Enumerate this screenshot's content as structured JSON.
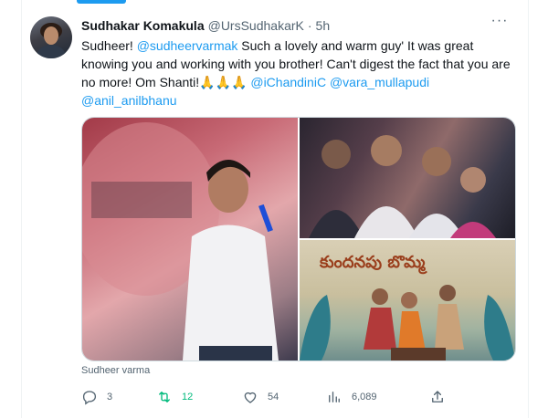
{
  "tweet": {
    "author_name": "Sudhakar Komakula",
    "author_handle": "@UrsSudhakarK",
    "separator": "·",
    "time": "5h",
    "more_label": "···",
    "text_parts": [
      {
        "t": "Sudheer! ",
        "mention": false
      },
      {
        "t": "@sudheervarmak",
        "mention": true
      },
      {
        "t": " Such a lovely and warm guy' It was great knowing you and working with you brother! Can't digest the fact that you are no more! Om Shanti!🙏🙏🙏 ",
        "mention": false
      },
      {
        "t": "@iChandiniC",
        "mention": true
      },
      {
        "t": " ",
        "mention": false
      },
      {
        "t": "@vara_mullapudi",
        "mention": true
      },
      {
        "t": " ",
        "mention": false
      },
      {
        "t": "@anil_anilbhanu",
        "mention": true
      }
    ],
    "media_caption": "Sudheer varma",
    "media_bottom_title": "కుందనపు బొమ్మ",
    "stats": {
      "replies": "3",
      "retweets": "12",
      "likes": "54",
      "views": "6,089"
    }
  },
  "colors": {
    "accent": "#1d9bf0",
    "retweet": "#00ba7c",
    "muted": "#536471"
  },
  "icons": [
    "reply-icon",
    "retweet-icon",
    "like-icon",
    "views-icon",
    "share-icon"
  ]
}
